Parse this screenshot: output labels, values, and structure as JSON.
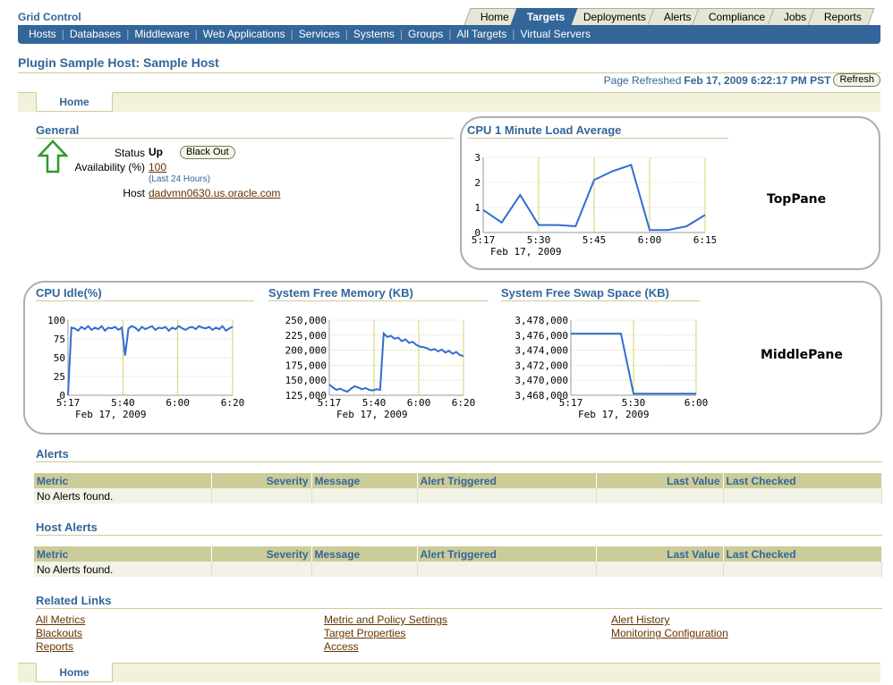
{
  "app_title": "Grid Control",
  "tabs": [
    "Home",
    "Targets",
    "Deployments",
    "Alerts",
    "Compliance",
    "Jobs",
    "Reports"
  ],
  "active_tab": "Targets",
  "subnav": [
    "Hosts",
    "Databases",
    "Middleware",
    "Web Applications",
    "Services",
    "Systems",
    "Groups",
    "All Targets",
    "Virtual Servers"
  ],
  "page_title": "Plugin Sample Host: Sample Host",
  "refresh": {
    "prefix": "Page Refreshed",
    "timestamp": "Feb 17, 2009 6:22:17 PM PST",
    "button": "Refresh"
  },
  "subtab": "Home",
  "general": {
    "header": "General",
    "status_label": "Status",
    "status_value": "Up",
    "blackout_button": "Black Out",
    "availability_label": "Availability (%)",
    "availability_value": "100",
    "availability_note": "(Last 24 Hours)",
    "host_label": "Host",
    "host_value": "dadvmn0630.us.oracle.com",
    "status_icon": "up-arrow-icon"
  },
  "top_pane": {
    "label": "TopPane",
    "chart_header": "CPU 1 Minute Load Average"
  },
  "middle_pane": {
    "label": "MiddlePane",
    "headers": [
      "CPU Idle(%)",
      "System Free Memory (KB)",
      "System Free Swap Space (KB)"
    ]
  },
  "chart_data": [
    {
      "type": "line",
      "title": "CPU 1 Minute Load Average",
      "x_ticks": [
        "5:17",
        "5:30",
        "5:45",
        "6:00",
        "6:15"
      ],
      "x_sublabel": "Feb 17, 2009",
      "y_ticks": [
        "0",
        "1",
        "2",
        "3"
      ],
      "ylim": [
        0,
        3
      ],
      "x": [
        "5:17",
        "5:22",
        "5:26",
        "5:31",
        "5:37",
        "5:43",
        "5:48",
        "5:52",
        "5:57",
        "6:02",
        "6:07",
        "6:12",
        "6:17"
      ],
      "values": [
        0.9,
        0.4,
        1.5,
        0.3,
        0.3,
        0.25,
        2.1,
        2.45,
        2.7,
        0.1,
        0.1,
        0.25,
        0.7
      ],
      "color": "#336cd2",
      "grid": true
    },
    {
      "type": "line",
      "title": "CPU Idle(%)",
      "x_ticks": [
        "5:17",
        "5:40",
        "6:00",
        "6:20"
      ],
      "x_sublabel": "Feb 17, 2009",
      "y_ticks": [
        "0",
        "25",
        "50",
        "75",
        "100"
      ],
      "ylim": [
        0,
        100
      ],
      "values": [
        0,
        90,
        89,
        86,
        91,
        88,
        92,
        87,
        90,
        88,
        92,
        86,
        90,
        89,
        91,
        87,
        90,
        53,
        89,
        92,
        90,
        86,
        91,
        88,
        90,
        92,
        87,
        90,
        89,
        91,
        86,
        90,
        88,
        92,
        89,
        87,
        90,
        91,
        88,
        92,
        90,
        89,
        91,
        87,
        90,
        88,
        92,
        86,
        89,
        91
      ],
      "color": "#336cd2",
      "grid": true
    },
    {
      "type": "line",
      "title": "System Free Memory (KB)",
      "x_ticks": [
        "5:17",
        "5:40",
        "6:00",
        "6:20"
      ],
      "x_sublabel": "Feb 17, 2009",
      "y_ticks": [
        "125,000",
        "150,000",
        "175,000",
        "200,000",
        "225,000",
        "250,000"
      ],
      "ylim": [
        125000,
        250000
      ],
      "values": [
        143000,
        138000,
        134000,
        136000,
        133000,
        131000,
        136000,
        140000,
        138000,
        135000,
        137000,
        134000,
        133000,
        135000,
        134000,
        228000,
        222000,
        224000,
        219000,
        221000,
        215000,
        218000,
        212000,
        214000,
        209000,
        206000,
        205000,
        203000,
        200000,
        202000,
        198000,
        201000,
        196000,
        199000,
        194000,
        197000,
        192000,
        190000
      ],
      "color": "#336cd2",
      "grid": true
    },
    {
      "type": "line",
      "title": "System Free Swap Space (KB)",
      "x_ticks": [
        "5:17",
        "5:30",
        "6:00"
      ],
      "x_sublabel": "Feb 17, 2009",
      "y_ticks": [
        "3,468,000",
        "3,470,000",
        "3,472,000",
        "3,474,000",
        "3,476,000",
        "3,478,000"
      ],
      "ylim": [
        3468000,
        3478000
      ],
      "values": [
        3476200,
        3476200,
        3476200,
        3476200,
        3476200,
        3468200,
        3468200,
        3468200,
        3468200,
        3468200,
        3468200
      ],
      "color": "#336cd2",
      "grid": true
    }
  ],
  "alerts": {
    "header": "Alerts",
    "columns": [
      "Metric",
      "Severity",
      "Message",
      "Alert Triggered",
      "Last Value",
      "Last Checked"
    ],
    "empty": "No Alerts found."
  },
  "host_alerts": {
    "header": "Host Alerts",
    "columns": [
      "Metric",
      "Severity",
      "Message",
      "Alert Triggered",
      "Last Value",
      "Last Checked"
    ],
    "empty": "No Alerts found."
  },
  "related_links": {
    "header": "Related Links",
    "col1": [
      "All Metrics",
      "Blackouts",
      "Reports"
    ],
    "col2": [
      "Metric and Policy Settings",
      "Target Properties",
      "Access"
    ],
    "col3": [
      "Alert History",
      "Monitoring Configuration"
    ]
  },
  "bottom_subtab": "Home"
}
